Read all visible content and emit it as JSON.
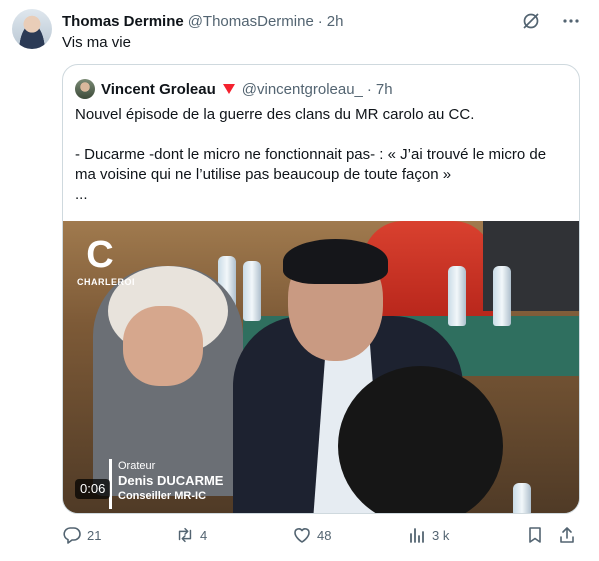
{
  "tweet": {
    "author_name": "Thomas Dermine",
    "author_handle": "@ThomasDermine",
    "separator": "·",
    "time": "2h",
    "text": "Vis ma vie"
  },
  "quote": {
    "author_name": "Vincent Groleau",
    "author_handle": "@vincentgroleau_",
    "separator": "·",
    "time": "7h",
    "line1": "Nouvel épisode de la guerre des clans du MR carolo au CC.",
    "line2": "- Ducarme -dont le micro ne fonctionnait pas- : « J’ai trouvé le micro de ma voisine qui ne l’utilise pas beaucoup de toute façon »",
    "line3": "..."
  },
  "video": {
    "logo_letter": "C",
    "logo_text": "CHARLEROI",
    "role": "Orateur",
    "speaker": "Denis DUCARME",
    "speaker_title": "Conseiller  MR-IC",
    "duration": "0:06"
  },
  "actions": {
    "replies": "21",
    "reposts": "4",
    "likes": "48",
    "views": "3 k"
  },
  "icons": {
    "grok": "grok-icon",
    "more": "more-icon",
    "reply": "reply-icon",
    "repost": "repost-icon",
    "like": "heart-icon",
    "views": "views-icon",
    "bookmark": "bookmark-icon",
    "share": "share-icon",
    "badge": "triangle-badge-icon"
  },
  "colors": {
    "text": "#0f1419",
    "secondary": "#536471",
    "border": "#cfd9de",
    "badge": "#f4212e"
  }
}
